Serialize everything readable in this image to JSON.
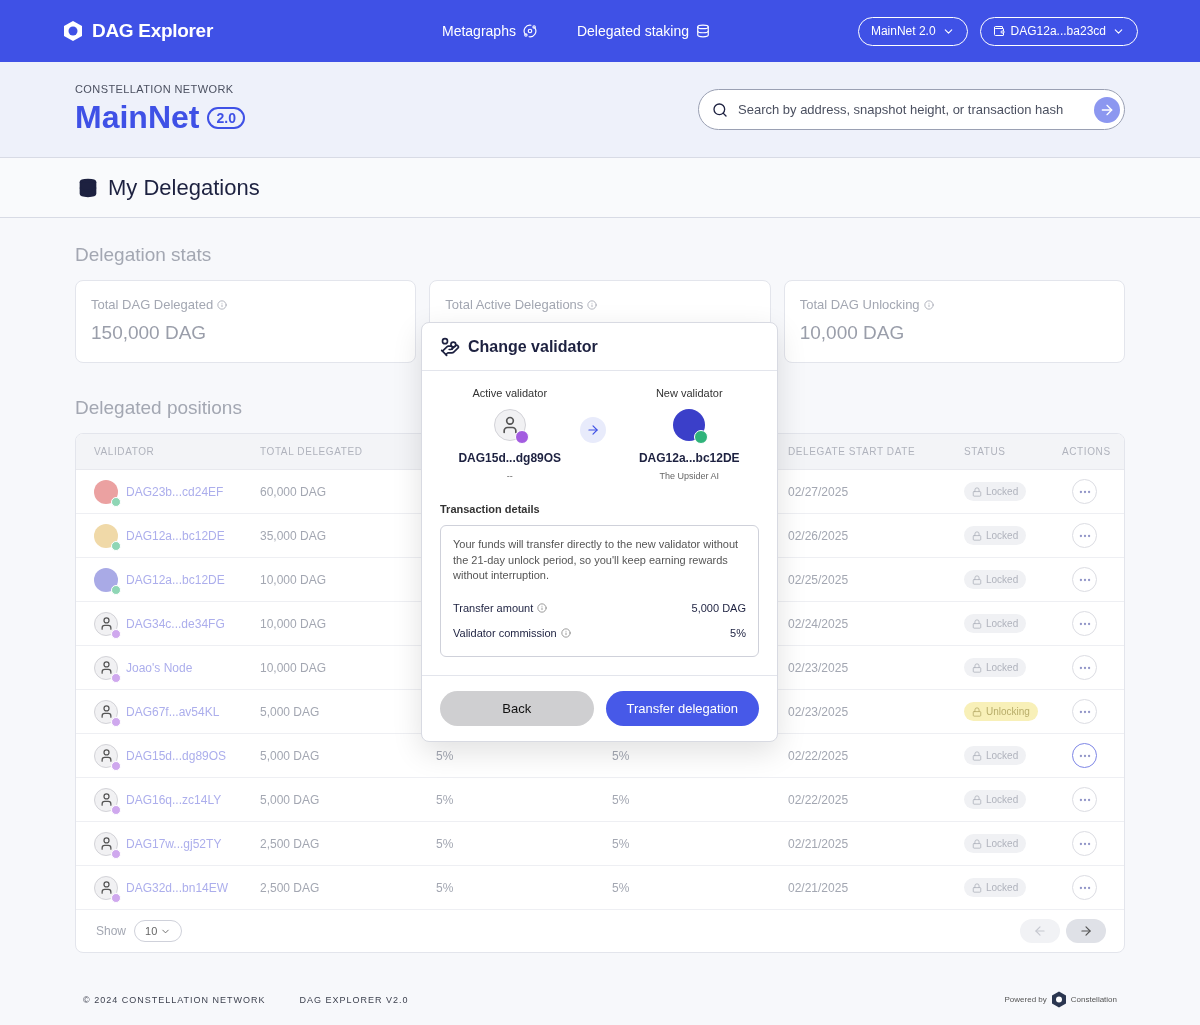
{
  "nav": {
    "logo": "DAG Explorer",
    "links": [
      {
        "label": "Metagraphs"
      },
      {
        "label": "Delegated staking"
      }
    ],
    "network_select": "MainNet 2.0",
    "wallet_select": "DAG12a...ba23cd"
  },
  "hero": {
    "eyebrow": "CONSTELLATION NETWORK",
    "title": "MainNet",
    "badge": "2.0",
    "search": {
      "placeholder": "Search by address, snapshot height, or transaction hash"
    }
  },
  "page_title": "My Delegations",
  "stats": {
    "heading": "Delegation stats",
    "cards": [
      {
        "label": "Total DAG Delegated",
        "value": "150,000 DAG"
      },
      {
        "label": "Total Active Delegations"
      },
      {
        "label": "Total DAG Unlocking",
        "value": "10,000 DAG"
      }
    ]
  },
  "positions": {
    "heading": "Delegated positions",
    "columns": {
      "validator": "VALIDATOR",
      "total_delegated": "TOTAL DELEGATED",
      "start_date": "DELEGATE START DATE",
      "status": "STATUS",
      "actions": "ACTIONS"
    },
    "rows": [
      {
        "validator": "DAG23b...cd24EF",
        "avatar": {
          "kind": "photo",
          "color": "#eba1a1"
        },
        "badge": {
          "color": "#8fd6b5"
        },
        "total": "60,000 DAG",
        "start_date": "02/27/2025",
        "status": {
          "kind": "locked",
          "label": "Locked"
        },
        "selected": false
      },
      {
        "validator": "DAG12a...bc12DE",
        "avatar": {
          "kind": "photo",
          "color": "#f0d9a8"
        },
        "badge": {
          "color": "#8fd6b5"
        },
        "total": "35,000 DAG",
        "start_date": "02/26/2025",
        "status": {
          "kind": "locked",
          "label": "Locked"
        },
        "selected": false
      },
      {
        "validator": "DAG12a...bc12DE",
        "avatar": {
          "kind": "photo",
          "color": "#a9aae6"
        },
        "badge": {
          "color": "#8fd6b5"
        },
        "total": "10,000 DAG",
        "start_date": "02/25/2025",
        "status": {
          "kind": "locked",
          "label": "Locked"
        },
        "selected": false
      },
      {
        "validator": "DAG34c...de34FG",
        "avatar": {
          "kind": "default"
        },
        "badge": {
          "color": "#cfa8ee"
        },
        "total": "10,000 DAG",
        "start_date": "02/24/2025",
        "status": {
          "kind": "locked",
          "label": "Locked"
        },
        "selected": false
      },
      {
        "validator": "Joao's Node",
        "avatar": {
          "kind": "default"
        },
        "badge": {
          "color": "#cfa8ee"
        },
        "total": "10,000 DAG",
        "start_date": "02/23/2025",
        "status": {
          "kind": "locked",
          "label": "Locked"
        },
        "selected": false
      },
      {
        "validator": "DAG67f...av54KL",
        "avatar": {
          "kind": "default"
        },
        "badge": {
          "color": "#cfa8ee"
        },
        "total": "5,000 DAG",
        "start_date": "02/23/2025",
        "status": {
          "kind": "unlocking",
          "label": "Unlocking"
        },
        "selected": false
      },
      {
        "validator": "DAG15d...dg89OS",
        "avatar": {
          "kind": "default"
        },
        "badge": {
          "color": "#cfa8ee"
        },
        "total": "5,000 DAG",
        "column_3": "5%",
        "column_4": "5%",
        "start_date": "02/22/2025",
        "status": {
          "kind": "locked",
          "label": "Locked"
        },
        "selected": true
      },
      {
        "validator": "DAG16q...zc14LY",
        "avatar": {
          "kind": "default"
        },
        "badge": {
          "color": "#cfa8ee"
        },
        "total": "5,000 DAG",
        "column_3": "5%",
        "column_4": "5%",
        "start_date": "02/22/2025",
        "status": {
          "kind": "locked",
          "label": "Locked"
        },
        "selected": false
      },
      {
        "validator": "DAG17w...gj52TY",
        "avatar": {
          "kind": "default"
        },
        "badge": {
          "color": "#cfa8ee"
        },
        "total": "2,500 DAG",
        "column_3": "5%",
        "column_4": "5%",
        "start_date": "02/21/2025",
        "status": {
          "kind": "locked",
          "label": "Locked"
        },
        "selected": false
      },
      {
        "validator": "DAG32d...bn14EW",
        "avatar": {
          "kind": "default"
        },
        "badge": {
          "color": "#cfa8ee"
        },
        "total": "2,500 DAG",
        "column_3": "5%",
        "column_4": "5%",
        "start_date": "02/21/2025",
        "status": {
          "kind": "locked",
          "label": "Locked"
        },
        "selected": false
      }
    ],
    "pagination": {
      "show_label": "Show",
      "page_size": "10",
      "prev_disabled": true,
      "next_disabled": false
    }
  },
  "modal": {
    "title": "Change validator",
    "active": {
      "heading": "Active validator",
      "address": "DAG15d...dg89OS",
      "subtitle": "--",
      "avatar": {
        "kind": "default"
      },
      "badge": {
        "color": "#a35ce0"
      }
    },
    "new": {
      "heading": "New validator",
      "address": "DAG12a...bc12DE",
      "subtitle": "The Upsider AI",
      "avatar": {
        "kind": "photo",
        "color": "#3b3fc9"
      },
      "badge": {
        "color": "#2fb37a"
      }
    },
    "details_heading": "Transaction details",
    "note": "Your funds will transfer directly to the new validator without the 21-day unlock period, so you'll keep earning rewards without interruption.",
    "details": [
      {
        "label": "Transfer amount",
        "value": "5,000 DAG"
      },
      {
        "label": "Validator commission",
        "value": "5%"
      }
    ],
    "buttons": {
      "back": "Back",
      "confirm": "Transfer delegation"
    }
  },
  "footer": {
    "copyright": "© 2024 CONSTELLATION NETWORK",
    "version": "DAG EXPLORER V2.0",
    "powered_by": "Powered by",
    "brand": "Constellation"
  }
}
